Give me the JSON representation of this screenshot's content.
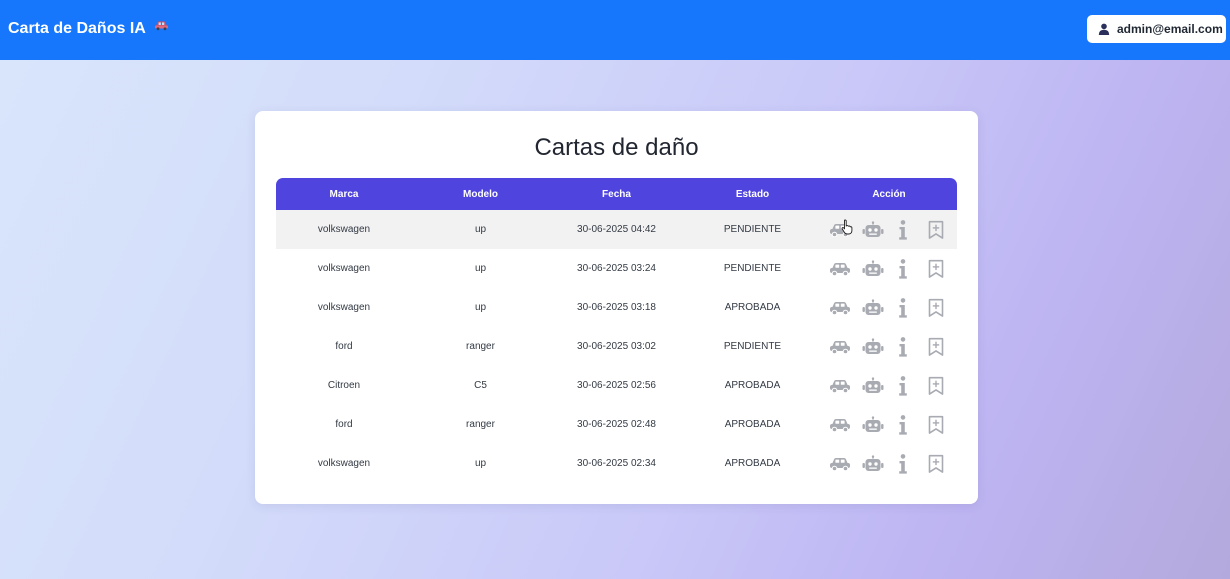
{
  "navbar": {
    "brand": "Carta de Daños IA",
    "brand_icon": "car-icon",
    "user_email": "admin@email.com",
    "user_icon": "user-icon"
  },
  "main": {
    "title": "Cartas de daño",
    "columns": [
      "Marca",
      "Modelo",
      "Fecha",
      "Estado",
      "Acción"
    ],
    "rows": [
      {
        "marca": "volkswagen",
        "modelo": "up",
        "fecha": "30-06-2025 04:42",
        "estado": "PENDIENTE"
      },
      {
        "marca": "volkswagen",
        "modelo": "up",
        "fecha": "30-06-2025 03:24",
        "estado": "PENDIENTE"
      },
      {
        "marca": "volkswagen",
        "modelo": "up",
        "fecha": "30-06-2025 03:18",
        "estado": "APROBADA"
      },
      {
        "marca": "ford",
        "modelo": "ranger",
        "fecha": "30-06-2025 03:02",
        "estado": "PENDIENTE"
      },
      {
        "marca": "Citroen",
        "modelo": "C5",
        "fecha": "30-06-2025 02:56",
        "estado": "APROBADA"
      },
      {
        "marca": "ford",
        "modelo": "ranger",
        "fecha": "30-06-2025 02:48",
        "estado": "APROBADA"
      },
      {
        "marca": "volkswagen",
        "modelo": "up",
        "fecha": "30-06-2025 02:34",
        "estado": "APROBADA"
      }
    ],
    "action_icons": [
      "car-icon",
      "robot-icon",
      "info-icon",
      "bookmark-plus-icon"
    ]
  },
  "colors": {
    "navbar": "#1677fc",
    "table_header": "#4f44dd",
    "action_icon": "#a9abb2"
  }
}
